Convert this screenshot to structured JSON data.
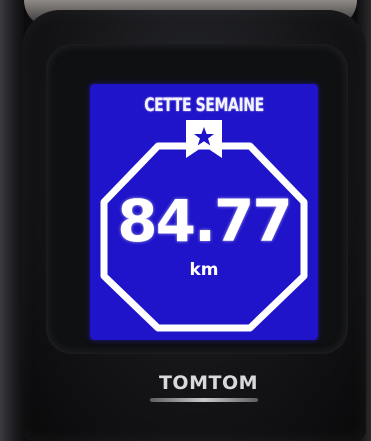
{
  "screen": {
    "title": "CETTE SEMAINE",
    "distance": "84.77",
    "unit": "km",
    "background_color": "#1f14c9",
    "icon": "bookmark-star-icon"
  },
  "device": {
    "brand": "TOMTOM"
  }
}
